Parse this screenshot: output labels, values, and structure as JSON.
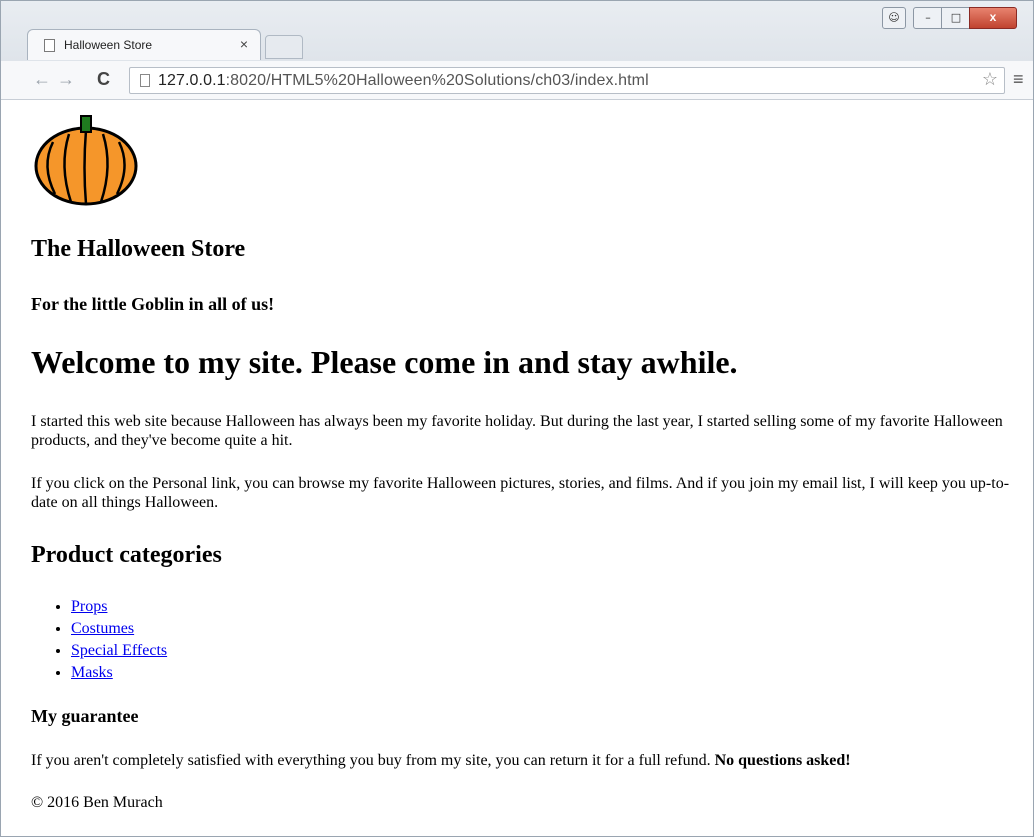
{
  "browser": {
    "tab_title": "Halloween Store",
    "tab_close": "×",
    "url_host": "127.0.0.1",
    "url_rest": ":8020/HTML5%20Halloween%20Solutions/ch03/index.html",
    "back_icon": "←",
    "forward_icon": "→",
    "reload_icon": "C",
    "star_icon": "☆",
    "menu_icon": "≡",
    "user_icon": "user-icon",
    "close_glyph": "x"
  },
  "page": {
    "store_title": "The Halloween Store",
    "tagline": "For the little Goblin in all of us!",
    "welcome": "Welcome to my site. Please come in and stay awhile.",
    "intro_1": "I started this web site because Halloween has always been my favorite holiday. But during the last year, I started selling some of my favorite Halloween products, and they've become quite a hit.",
    "intro_2": "If you click on the Personal link, you can browse my favorite Halloween pictures, stories, and films. And if you join my email list, I will keep you up-to-date on all things Halloween.",
    "categories_heading": "Product categories",
    "categories": [
      "Props",
      "Costumes",
      "Special Effects",
      "Masks"
    ],
    "guarantee_heading": "My guarantee",
    "guarantee_text": "If you aren't completely satisfied with everything you buy from my site, you can return it for a full refund. ",
    "guarantee_bold": "No questions asked!",
    "footer": "© 2016 Ben Murach"
  },
  "colors": {
    "link": "#0000ee",
    "pumpkin": "#f5962a",
    "stem": "#1f7a1f"
  }
}
